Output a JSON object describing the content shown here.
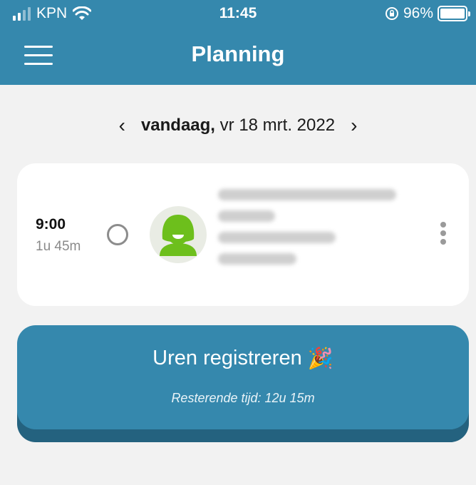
{
  "status_bar": {
    "carrier": "KPN",
    "time": "11:45",
    "battery_percent": "96%",
    "icons": [
      "signal-icon",
      "wifi-icon",
      "rotation-lock-icon",
      "battery-icon"
    ]
  },
  "header": {
    "title": "Planning",
    "menu_icon": "hamburger-menu-icon",
    "background_color": "#3588ad"
  },
  "date_nav": {
    "prev_icon": "chevron-left-icon",
    "next_icon": "chevron-right-icon",
    "day_label": "vandaag,",
    "date": "vr 18 mrt. 2022"
  },
  "appointment": {
    "start_time": "9:00",
    "duration": "1u 45m",
    "status_icon": "empty-circle-icon",
    "avatar_icon": "user-avatar-icon",
    "details_redacted": true,
    "more_icon": "more-vertical-icon"
  },
  "register": {
    "label": "Uren registreren",
    "emoji": "🎉",
    "remaining": "Resterende tijd: 12u 15m",
    "color": "#3588ad"
  }
}
